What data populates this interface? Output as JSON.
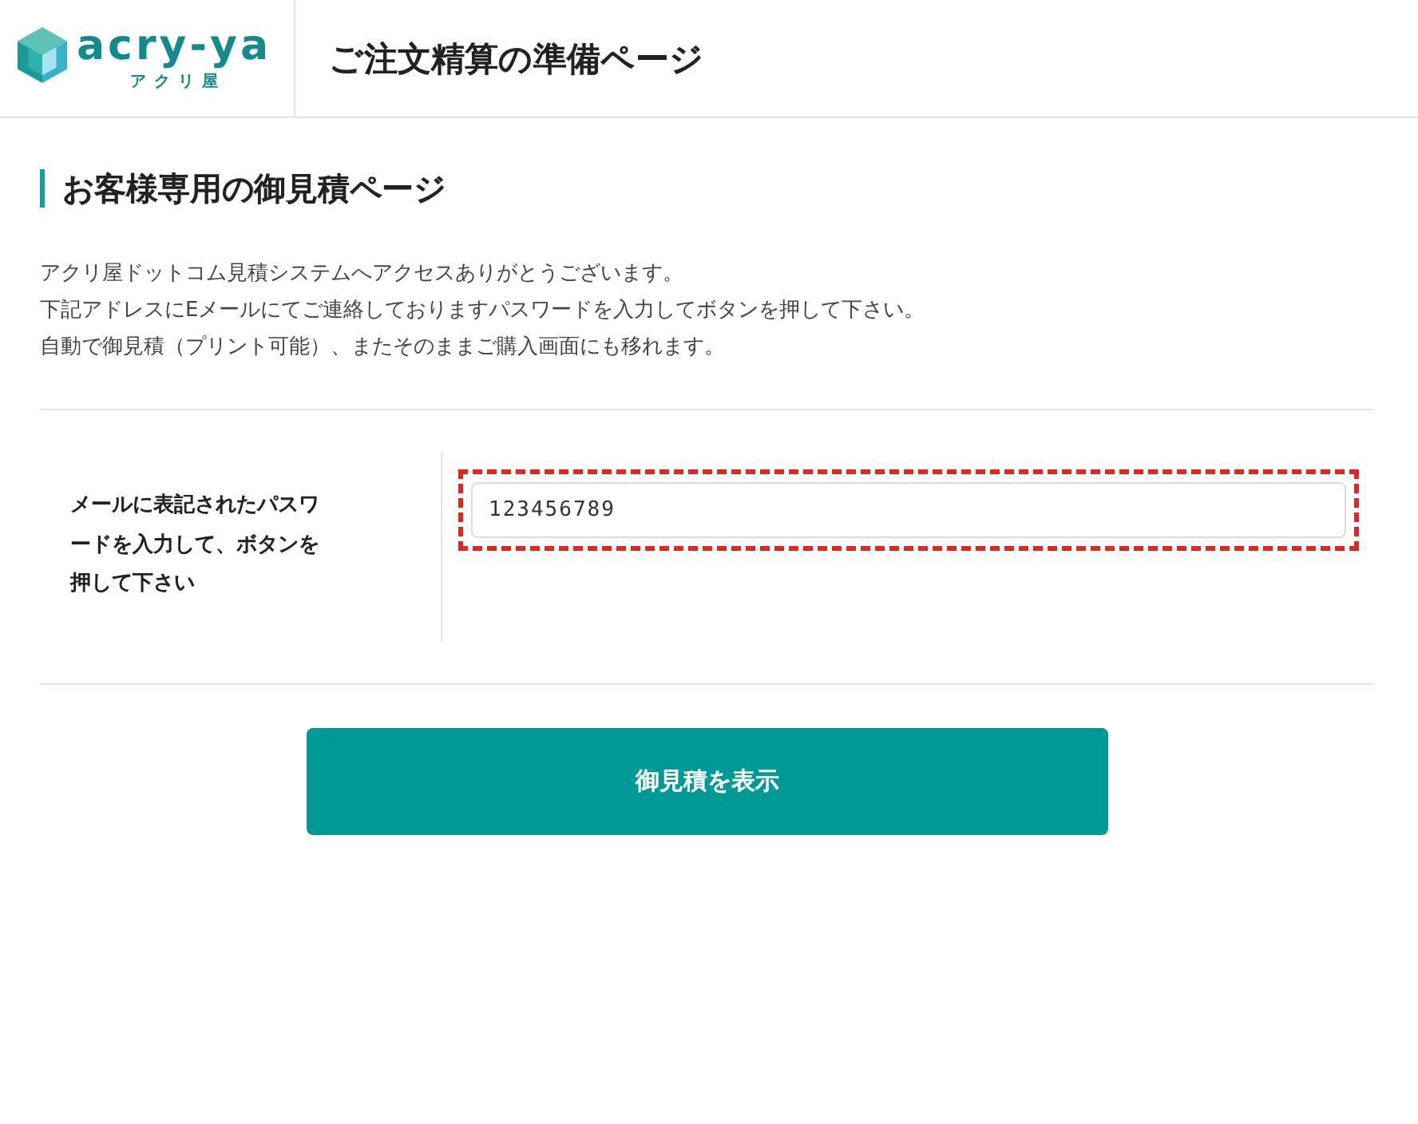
{
  "header": {
    "logo": {
      "wordmark": "acry-ya",
      "subtitle": "アクリ屋"
    },
    "title": "ご注文精算の準備ページ"
  },
  "section": {
    "heading": "お客様専用の御見積ページ",
    "intro": [
      "アクリ屋ドットコム見積システムへアクセスありがとうございます。",
      "下記アドレスにEメールにてご連絡しておりますパスワードを入力してボタンを押して下さい。",
      "自動で御見積（プリント可能）、またそのままご購入画面にも移れます。"
    ]
  },
  "form": {
    "label": "メールに表記されたパスワードを入力して、ボタンを押して下さい",
    "password": {
      "value": "123456789",
      "highlighted": true
    }
  },
  "button": {
    "label": "御見積を表示"
  }
}
